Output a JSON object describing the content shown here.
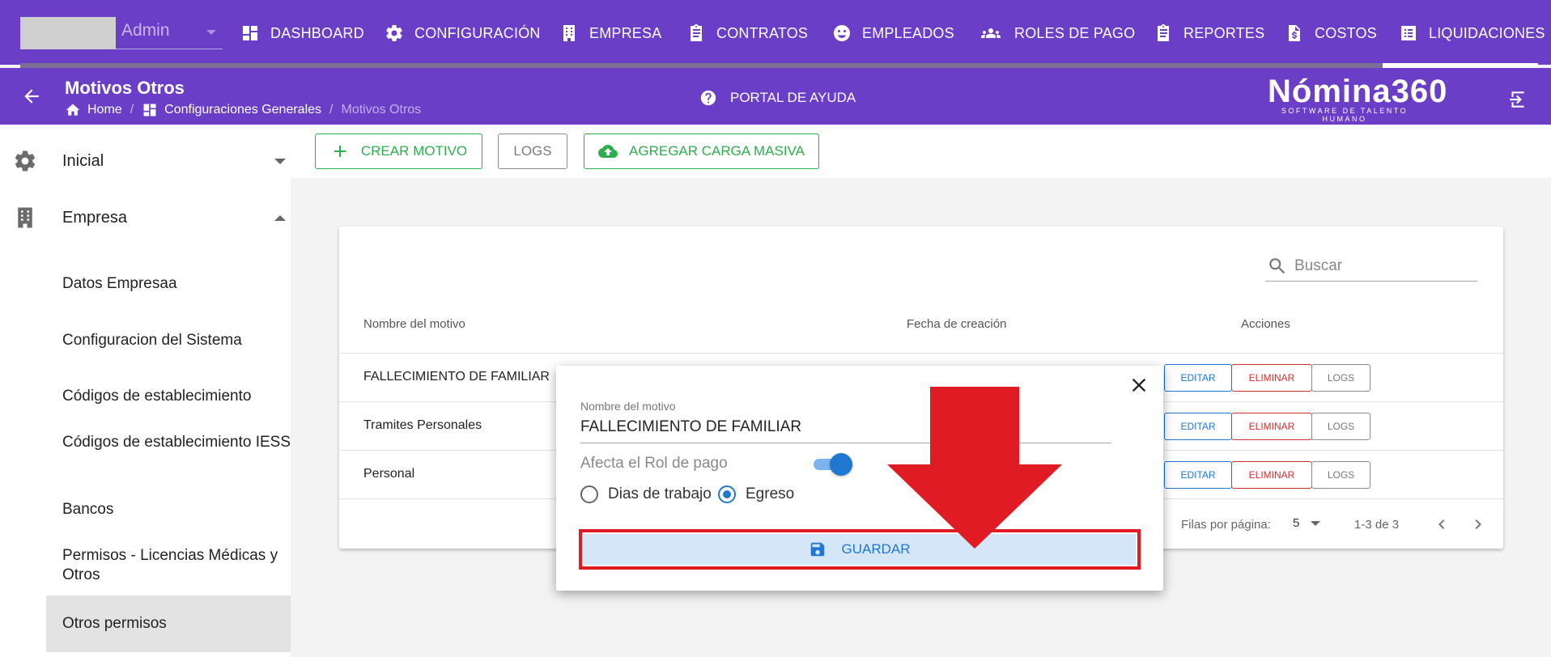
{
  "user": {
    "name": "Admin"
  },
  "nav": [
    {
      "label": "DASHBOARD",
      "icon": "dashboard-icon"
    },
    {
      "label": "CONFIGURACIÓN",
      "icon": "gear-icon"
    },
    {
      "label": "EMPRESA",
      "icon": "building-icon"
    },
    {
      "label": "CONTRATOS",
      "icon": "clipboard-icon"
    },
    {
      "label": "EMPLEADOS",
      "icon": "face-icon"
    },
    {
      "label": "ROLES DE PAGO",
      "icon": "people-icon"
    },
    {
      "label": "REPORTES",
      "icon": "clipboard-icon"
    },
    {
      "label": "COSTOS",
      "icon": "dollar-file-icon"
    },
    {
      "label": "LIQUIDACIONES",
      "icon": "list-icon"
    }
  ],
  "header": {
    "title": "Motivos Otros",
    "breadcrumb": {
      "home": "Home",
      "section": "Configuraciones Generales",
      "current": "Motivos Otros"
    },
    "help": "PORTAL DE AYUDA",
    "brand_name": "Nómina360",
    "brand_tagline": "SOFTWARE DE TALENTO HUMANO"
  },
  "sidebar": {
    "groups": [
      {
        "label": "Inicial"
      },
      {
        "label": "Empresa"
      }
    ],
    "items": [
      {
        "label": "Datos Empresaa"
      },
      {
        "label": "Configuracion del Sistema"
      },
      {
        "label": "Códigos de establecimiento"
      },
      {
        "label": "Códigos de establecimiento IESS"
      },
      {
        "label": "Bancos"
      },
      {
        "label": "Permisos - Licencias Médicas y Otros"
      },
      {
        "label": "Otros permisos"
      }
    ]
  },
  "toolbar": {
    "create": "CREAR MOTIVO",
    "logs": "LOGS",
    "bulk": "AGREGAR CARGA MASIVA"
  },
  "table": {
    "search_placeholder": "Buscar",
    "headers": {
      "name": "Nombre del motivo",
      "date": "Fecha de creación",
      "actions": "Acciones"
    },
    "rows": [
      {
        "name": "FALLECIMIENTO DE FAMILIAR"
      },
      {
        "name": "Tramites Personales"
      },
      {
        "name": "Personal"
      }
    ],
    "action_labels": {
      "edit": "EDITAR",
      "delete": "ELIMINAR",
      "logs": "LOGS"
    },
    "footer": {
      "rows_per_page_label": "Filas por página:",
      "rows_per_page": "5",
      "range": "1-3 de 3"
    }
  },
  "dialog": {
    "field_label": "Nombre del motivo",
    "field_value": "FALLECIMIENTO DE FAMILIAR",
    "switch_label": "Afecta el Rol de pago",
    "switch_on": true,
    "radio_1": "Dias de trabajo",
    "radio_2": "Egreso",
    "selected_radio": "Egreso",
    "save": "GUARDAR"
  },
  "colors": {
    "nav_bg": "#6a3ec7",
    "accent_green": "#2fae4e",
    "accent_blue": "#1f77d0",
    "danger": "#d32f2f",
    "annotation_red": "#e01b24"
  }
}
